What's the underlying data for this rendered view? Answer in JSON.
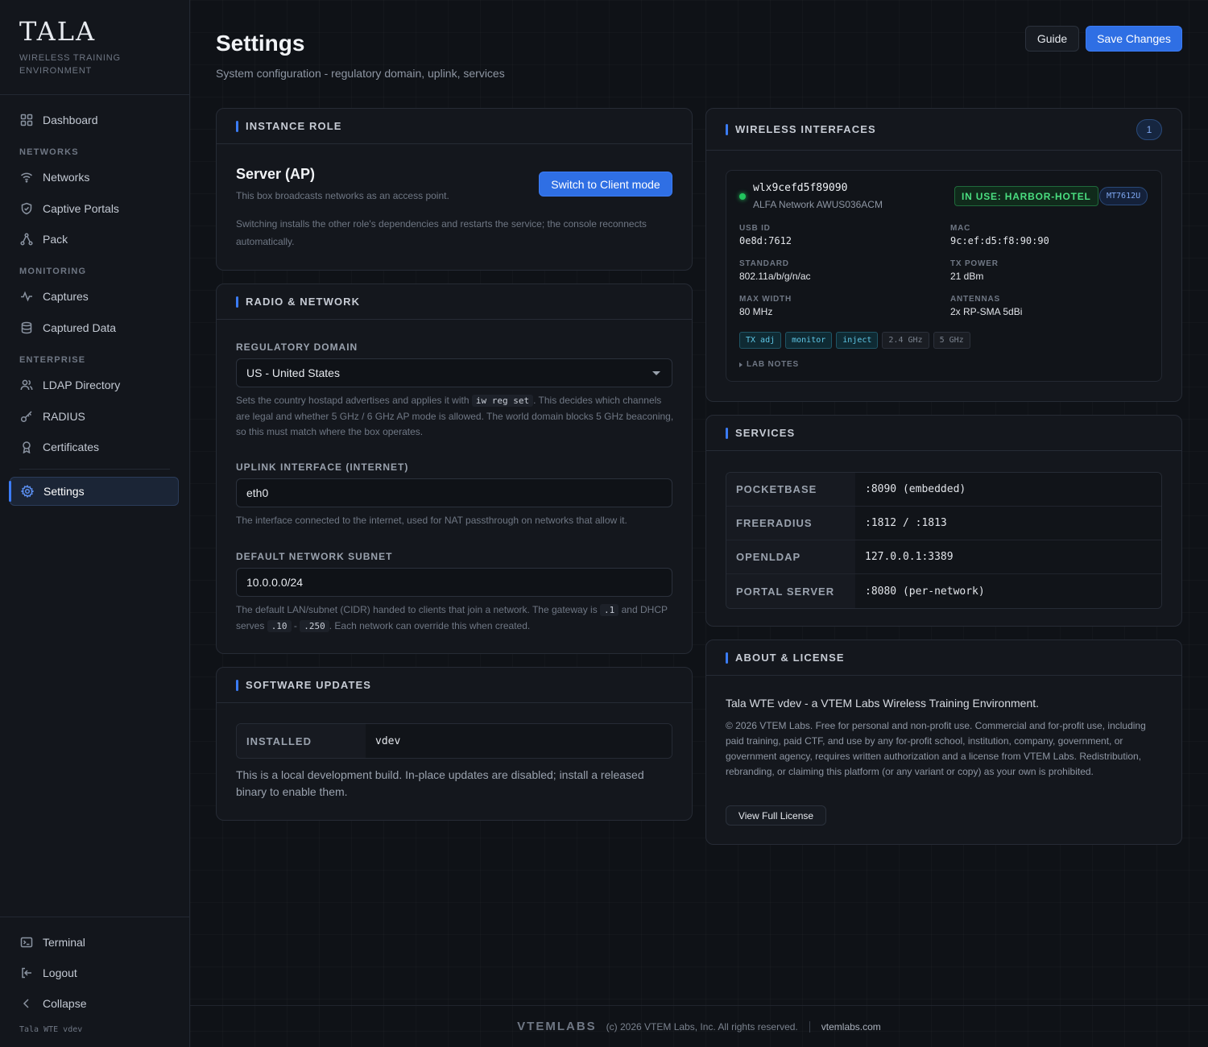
{
  "brand": {
    "logo_text": "TALA",
    "subtitle": "WIRELESS TRAINING ENVIRONMENT",
    "version_footer": "Tala WTE vdev"
  },
  "sidebar": {
    "top_items": [
      {
        "label": "Dashboard",
        "icon": "grid-icon"
      }
    ],
    "sections": [
      {
        "title": "NETWORKS",
        "items": [
          {
            "label": "Networks",
            "icon": "wifi-icon"
          },
          {
            "label": "Captive Portals",
            "icon": "shield-icon"
          },
          {
            "label": "Pack",
            "icon": "nodes-icon"
          }
        ]
      },
      {
        "title": "MONITORING",
        "items": [
          {
            "label": "Captures",
            "icon": "pulse-icon"
          },
          {
            "label": "Captured Data",
            "icon": "database-icon"
          }
        ]
      },
      {
        "title": "ENTERPRISE",
        "items": [
          {
            "label": "LDAP Directory",
            "icon": "users-icon"
          },
          {
            "label": "RADIUS",
            "icon": "key-icon"
          },
          {
            "label": "Certificates",
            "icon": "award-icon"
          }
        ]
      }
    ],
    "active_item": {
      "label": "Settings",
      "icon": "gear-icon"
    },
    "bottom_items": [
      {
        "label": "Terminal",
        "icon": "terminal-icon"
      },
      {
        "label": "Logout",
        "icon": "logout-icon"
      },
      {
        "label": "Collapse",
        "icon": "chevron-left-icon"
      }
    ]
  },
  "header": {
    "title": "Settings",
    "subtitle": "System configuration - regulatory domain, uplink, services",
    "guide_label": "Guide",
    "save_label": "Save Changes"
  },
  "instance_role": {
    "title": "INSTANCE ROLE",
    "role": "Server (AP)",
    "description": "This box broadcasts networks as an access point.",
    "switch_label": "Switch to Client mode",
    "note": "Switching installs the other role's dependencies and restarts the service; the console reconnects automatically."
  },
  "radio": {
    "title": "RADIO & NETWORK",
    "regdomain_label": "REGULATORY DOMAIN",
    "regdomain_value": "US - United States",
    "regdomain_help_1": "Sets the country hostapd advertises and applies it with",
    "regdomain_help_code": "iw reg set",
    "regdomain_help_2": ". This decides which channels are legal and whether 5 GHz / 6 GHz AP mode is allowed. The world domain blocks 5 GHz beaconing, so this must match where the box operates.",
    "uplink_label": "UPLINK INTERFACE (INTERNET)",
    "uplink_value": "eth0",
    "uplink_help": "The interface connected to the internet, used for NAT passthrough on networks that allow it.",
    "subnet_label": "DEFAULT NETWORK SUBNET",
    "subnet_value": "10.0.0.0/24",
    "subnet_help_1": "The default LAN/subnet (CIDR) handed to clients that join a network. The gateway is",
    "subnet_help_code_1": ".1",
    "subnet_help_2": "and DHCP serves",
    "subnet_help_code_2": ".10",
    "subnet_help_dash": "-",
    "subnet_help_code_3": ".250",
    "subnet_help_3": ". Each network can override this when created."
  },
  "updates": {
    "title": "SOFTWARE UPDATES",
    "installed_key": "INSTALLED",
    "installed_value": "vdev",
    "note": "This is a local development build. In-place updates are disabled; install a released binary to enable them."
  },
  "wireless": {
    "title": "WIRELESS INTERFACES",
    "count": "1",
    "iface": {
      "name": "wlx9cefd5f89090",
      "model": "ALFA Network AWUS036ACM",
      "status_color": "#22c55e",
      "in_use": "IN USE: HARBOR-HOTEL",
      "chipset": "MT7612U",
      "fields": [
        {
          "label": "USB ID",
          "value": "0e8d:7612",
          "mono": true
        },
        {
          "label": "MAC",
          "value": "9c:ef:d5:f8:90:90",
          "mono": true
        },
        {
          "label": "STANDARD",
          "value": "802.11a/b/g/n/ac",
          "mono": false
        },
        {
          "label": "TX POWER",
          "value": "21 dBm",
          "mono": false
        },
        {
          "label": "MAX WIDTH",
          "value": "80 MHz",
          "mono": false
        },
        {
          "label": "ANTENNAS",
          "value": "2x RP-SMA 5dBi",
          "mono": false
        }
      ],
      "tags": [
        {
          "label": "TX adj",
          "active": true
        },
        {
          "label": "monitor",
          "active": true
        },
        {
          "label": "inject",
          "active": true
        },
        {
          "label": "2.4 GHz",
          "active": false
        },
        {
          "label": "5 GHz",
          "active": false
        }
      ],
      "lab_notes": "LAB NOTES"
    }
  },
  "services": {
    "title": "SERVICES",
    "rows": [
      {
        "key": "POCKETBASE",
        "value": ":8090 (embedded)"
      },
      {
        "key": "FREERADIUS",
        "value": ":1812 / :1813"
      },
      {
        "key": "OPENLDAP",
        "value": "127.0.0.1:3389"
      },
      {
        "key": "PORTAL SERVER",
        "value": ":8080 (per-network)"
      }
    ]
  },
  "about": {
    "title": "ABOUT & LICENSE",
    "headline": "Tala WTE vdev - a VTEM Labs Wireless Training Environment.",
    "body": "© 2026 VTEM Labs. Free for personal and non-profit use. Commercial and for-profit use, including paid training, paid CTF, and use by any for-profit school, institution, company, government, or government agency, requires written authorization and a license from VTEM Labs. Redistribution, rebranding, or claiming this platform (or any variant or copy) as your own is prohibited.",
    "license_button": "View Full License"
  },
  "footer": {
    "logo_text": "VTEMLABS",
    "copyright": "(c) 2026 VTEM Labs, Inc. All rights reserved.",
    "link": "vtemlabs.com"
  },
  "colors": {
    "accent": "#3b7cf6",
    "success": "#22c55e",
    "background": "#0e1116"
  }
}
